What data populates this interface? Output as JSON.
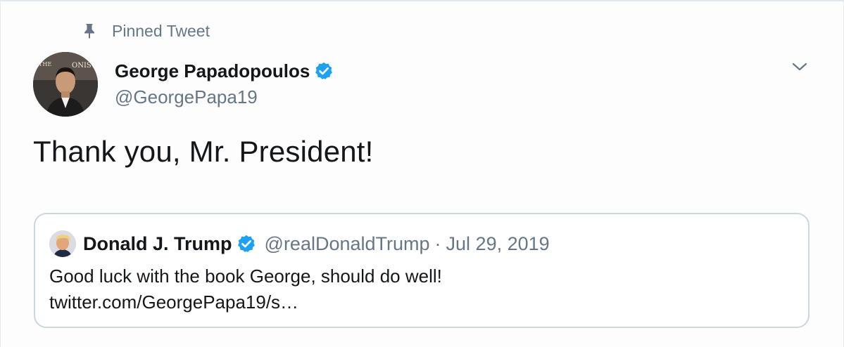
{
  "pinned": {
    "label": "Pinned Tweet",
    "icon": "pin-icon"
  },
  "author": {
    "display_name": "George Papadopoulos",
    "handle": "@GeorgePapa19",
    "verified": true
  },
  "tweet": {
    "text": "Thank you, Mr. President!"
  },
  "quoted_tweet": {
    "display_name": "Donald J. Trump",
    "handle": "@realDonaldTrump",
    "separator": "·",
    "date": "Jul 29, 2019",
    "verified": true,
    "text_line1": "Good luck with the book George, should do well!",
    "text_line2": "twitter.com/GeorgePapa19/s…"
  },
  "colors": {
    "verified_blue": "#1da1f2",
    "secondary_text": "#657786",
    "border": "#ccd6dd"
  }
}
